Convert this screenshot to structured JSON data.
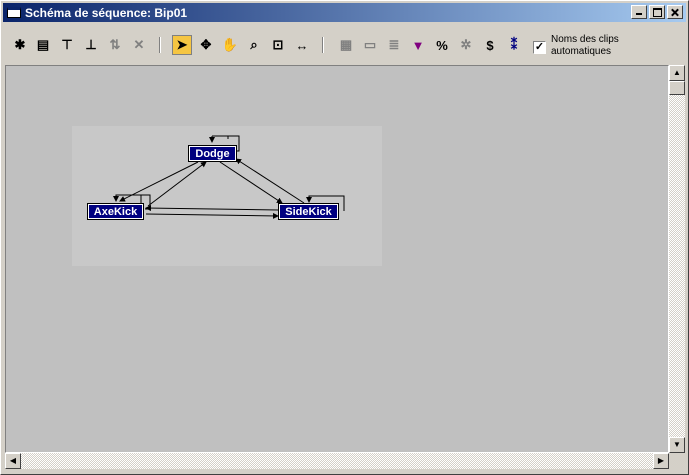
{
  "window": {
    "title": "Schéma de séquence: Bip01"
  },
  "toolbar": {
    "tools": [
      {
        "icon": "new-clip-icon",
        "glyph": "✱",
        "enabled": true
      },
      {
        "icon": "load-file-icon",
        "glyph": "▤",
        "enabled": true
      },
      {
        "icon": "insert-clip-icon",
        "glyph": "⊤",
        "enabled": true
      },
      {
        "icon": "insert-transition-icon",
        "glyph": "⊥",
        "enabled": true
      },
      {
        "icon": "swap-icon",
        "glyph": "⇅",
        "enabled": false
      },
      {
        "icon": "delete-icon",
        "glyph": "✕",
        "enabled": false
      },
      {
        "icon": "select-arrow-icon",
        "glyph": "➤",
        "enabled": true,
        "active": true
      },
      {
        "icon": "move-icon",
        "glyph": "✥",
        "enabled": true
      },
      {
        "icon": "pan-hand-icon",
        "glyph": "✋",
        "enabled": true
      },
      {
        "icon": "zoom-icon",
        "glyph": "⌕",
        "enabled": true
      },
      {
        "icon": "zoom-region-icon",
        "glyph": "⊡",
        "enabled": true
      },
      {
        "icon": "zoom-extents-icon",
        "glyph": "↔",
        "enabled": true
      },
      {
        "icon": "set-start-clip-icon",
        "glyph": "▦",
        "enabled": false
      },
      {
        "icon": "shared-motion-icon",
        "glyph": "▭",
        "enabled": false
      },
      {
        "icon": "properties-icon",
        "glyph": "≣",
        "enabled": false
      },
      {
        "icon": "marker-icon",
        "glyph": "▼",
        "enabled": true
      },
      {
        "icon": "percent-icon",
        "glyph": "%",
        "enabled": true
      },
      {
        "icon": "randomize-icon",
        "glyph": "✲",
        "enabled": false
      },
      {
        "icon": "cost-icon",
        "glyph": "$",
        "enabled": true
      },
      {
        "icon": "info-icon",
        "glyph": "⁑",
        "enabled": true
      }
    ],
    "auto_clip_names_checked": true,
    "auto_clip_names_label_line1": "Noms des clips",
    "auto_clip_names_label_line2": "automatiques"
  },
  "graph": {
    "nodes": [
      {
        "id": "dodge",
        "label": "Dodge"
      },
      {
        "id": "axekick",
        "label": "AxeKick"
      },
      {
        "id": "sidekick",
        "label": "SideKick"
      }
    ]
  }
}
